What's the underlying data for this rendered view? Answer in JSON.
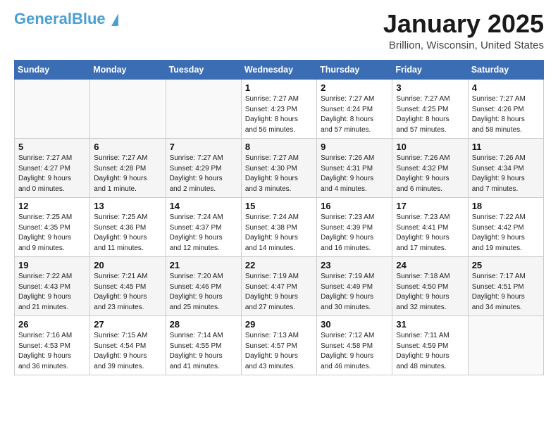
{
  "logo": {
    "line1": "General",
    "line2": "Blue",
    "tagline": ""
  },
  "header": {
    "month": "January 2025",
    "location": "Brillion, Wisconsin, United States"
  },
  "days_of_week": [
    "Sunday",
    "Monday",
    "Tuesday",
    "Wednesday",
    "Thursday",
    "Friday",
    "Saturday"
  ],
  "weeks": [
    [
      {
        "day": "",
        "info": ""
      },
      {
        "day": "",
        "info": ""
      },
      {
        "day": "",
        "info": ""
      },
      {
        "day": "1",
        "info": "Sunrise: 7:27 AM\nSunset: 4:23 PM\nDaylight: 8 hours\nand 56 minutes."
      },
      {
        "day": "2",
        "info": "Sunrise: 7:27 AM\nSunset: 4:24 PM\nDaylight: 8 hours\nand 57 minutes."
      },
      {
        "day": "3",
        "info": "Sunrise: 7:27 AM\nSunset: 4:25 PM\nDaylight: 8 hours\nand 57 minutes."
      },
      {
        "day": "4",
        "info": "Sunrise: 7:27 AM\nSunset: 4:26 PM\nDaylight: 8 hours\nand 58 minutes."
      }
    ],
    [
      {
        "day": "5",
        "info": "Sunrise: 7:27 AM\nSunset: 4:27 PM\nDaylight: 9 hours\nand 0 minutes."
      },
      {
        "day": "6",
        "info": "Sunrise: 7:27 AM\nSunset: 4:28 PM\nDaylight: 9 hours\nand 1 minute."
      },
      {
        "day": "7",
        "info": "Sunrise: 7:27 AM\nSunset: 4:29 PM\nDaylight: 9 hours\nand 2 minutes."
      },
      {
        "day": "8",
        "info": "Sunrise: 7:27 AM\nSunset: 4:30 PM\nDaylight: 9 hours\nand 3 minutes."
      },
      {
        "day": "9",
        "info": "Sunrise: 7:26 AM\nSunset: 4:31 PM\nDaylight: 9 hours\nand 4 minutes."
      },
      {
        "day": "10",
        "info": "Sunrise: 7:26 AM\nSunset: 4:32 PM\nDaylight: 9 hours\nand 6 minutes."
      },
      {
        "day": "11",
        "info": "Sunrise: 7:26 AM\nSunset: 4:34 PM\nDaylight: 9 hours\nand 7 minutes."
      }
    ],
    [
      {
        "day": "12",
        "info": "Sunrise: 7:25 AM\nSunset: 4:35 PM\nDaylight: 9 hours\nand 9 minutes."
      },
      {
        "day": "13",
        "info": "Sunrise: 7:25 AM\nSunset: 4:36 PM\nDaylight: 9 hours\nand 11 minutes."
      },
      {
        "day": "14",
        "info": "Sunrise: 7:24 AM\nSunset: 4:37 PM\nDaylight: 9 hours\nand 12 minutes."
      },
      {
        "day": "15",
        "info": "Sunrise: 7:24 AM\nSunset: 4:38 PM\nDaylight: 9 hours\nand 14 minutes."
      },
      {
        "day": "16",
        "info": "Sunrise: 7:23 AM\nSunset: 4:39 PM\nDaylight: 9 hours\nand 16 minutes."
      },
      {
        "day": "17",
        "info": "Sunrise: 7:23 AM\nSunset: 4:41 PM\nDaylight: 9 hours\nand 17 minutes."
      },
      {
        "day": "18",
        "info": "Sunrise: 7:22 AM\nSunset: 4:42 PM\nDaylight: 9 hours\nand 19 minutes."
      }
    ],
    [
      {
        "day": "19",
        "info": "Sunrise: 7:22 AM\nSunset: 4:43 PM\nDaylight: 9 hours\nand 21 minutes."
      },
      {
        "day": "20",
        "info": "Sunrise: 7:21 AM\nSunset: 4:45 PM\nDaylight: 9 hours\nand 23 minutes."
      },
      {
        "day": "21",
        "info": "Sunrise: 7:20 AM\nSunset: 4:46 PM\nDaylight: 9 hours\nand 25 minutes."
      },
      {
        "day": "22",
        "info": "Sunrise: 7:19 AM\nSunset: 4:47 PM\nDaylight: 9 hours\nand 27 minutes."
      },
      {
        "day": "23",
        "info": "Sunrise: 7:19 AM\nSunset: 4:49 PM\nDaylight: 9 hours\nand 30 minutes."
      },
      {
        "day": "24",
        "info": "Sunrise: 7:18 AM\nSunset: 4:50 PM\nDaylight: 9 hours\nand 32 minutes."
      },
      {
        "day": "25",
        "info": "Sunrise: 7:17 AM\nSunset: 4:51 PM\nDaylight: 9 hours\nand 34 minutes."
      }
    ],
    [
      {
        "day": "26",
        "info": "Sunrise: 7:16 AM\nSunset: 4:53 PM\nDaylight: 9 hours\nand 36 minutes."
      },
      {
        "day": "27",
        "info": "Sunrise: 7:15 AM\nSunset: 4:54 PM\nDaylight: 9 hours\nand 39 minutes."
      },
      {
        "day": "28",
        "info": "Sunrise: 7:14 AM\nSunset: 4:55 PM\nDaylight: 9 hours\nand 41 minutes."
      },
      {
        "day": "29",
        "info": "Sunrise: 7:13 AM\nSunset: 4:57 PM\nDaylight: 9 hours\nand 43 minutes."
      },
      {
        "day": "30",
        "info": "Sunrise: 7:12 AM\nSunset: 4:58 PM\nDaylight: 9 hours\nand 46 minutes."
      },
      {
        "day": "31",
        "info": "Sunrise: 7:11 AM\nSunset: 4:59 PM\nDaylight: 9 hours\nand 48 minutes."
      },
      {
        "day": "",
        "info": ""
      }
    ]
  ]
}
